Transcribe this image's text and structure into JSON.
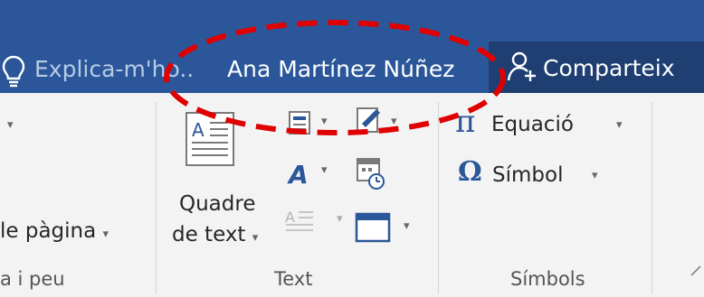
{
  "titlebar": {
    "tell_me": "Explica-m'ho..",
    "user_name": "Ana Martínez Núñez",
    "share_label": "Comparteix"
  },
  "ribbon": {
    "page_number_label": "le pàgina",
    "header_footer_group": "a i peu",
    "text_box_line1": "Quadre",
    "text_box_line2": "de text",
    "text_group": "Text",
    "equation_label": "Equació",
    "symbol_label": "Símbol",
    "symbols_group": "Símbols"
  },
  "colors": {
    "titlebar": "#2b579a",
    "share_button": "#1f3f73",
    "annotation": "#e00000",
    "wordart": "#2b579a"
  },
  "icons": [
    "lightbulb-icon",
    "share-person-icon",
    "text-box-icon",
    "quick-parts-icon",
    "signature-line-icon",
    "wordart-icon",
    "date-time-icon",
    "dropcap-icon",
    "object-icon",
    "pi-icon",
    "omega-icon"
  ]
}
